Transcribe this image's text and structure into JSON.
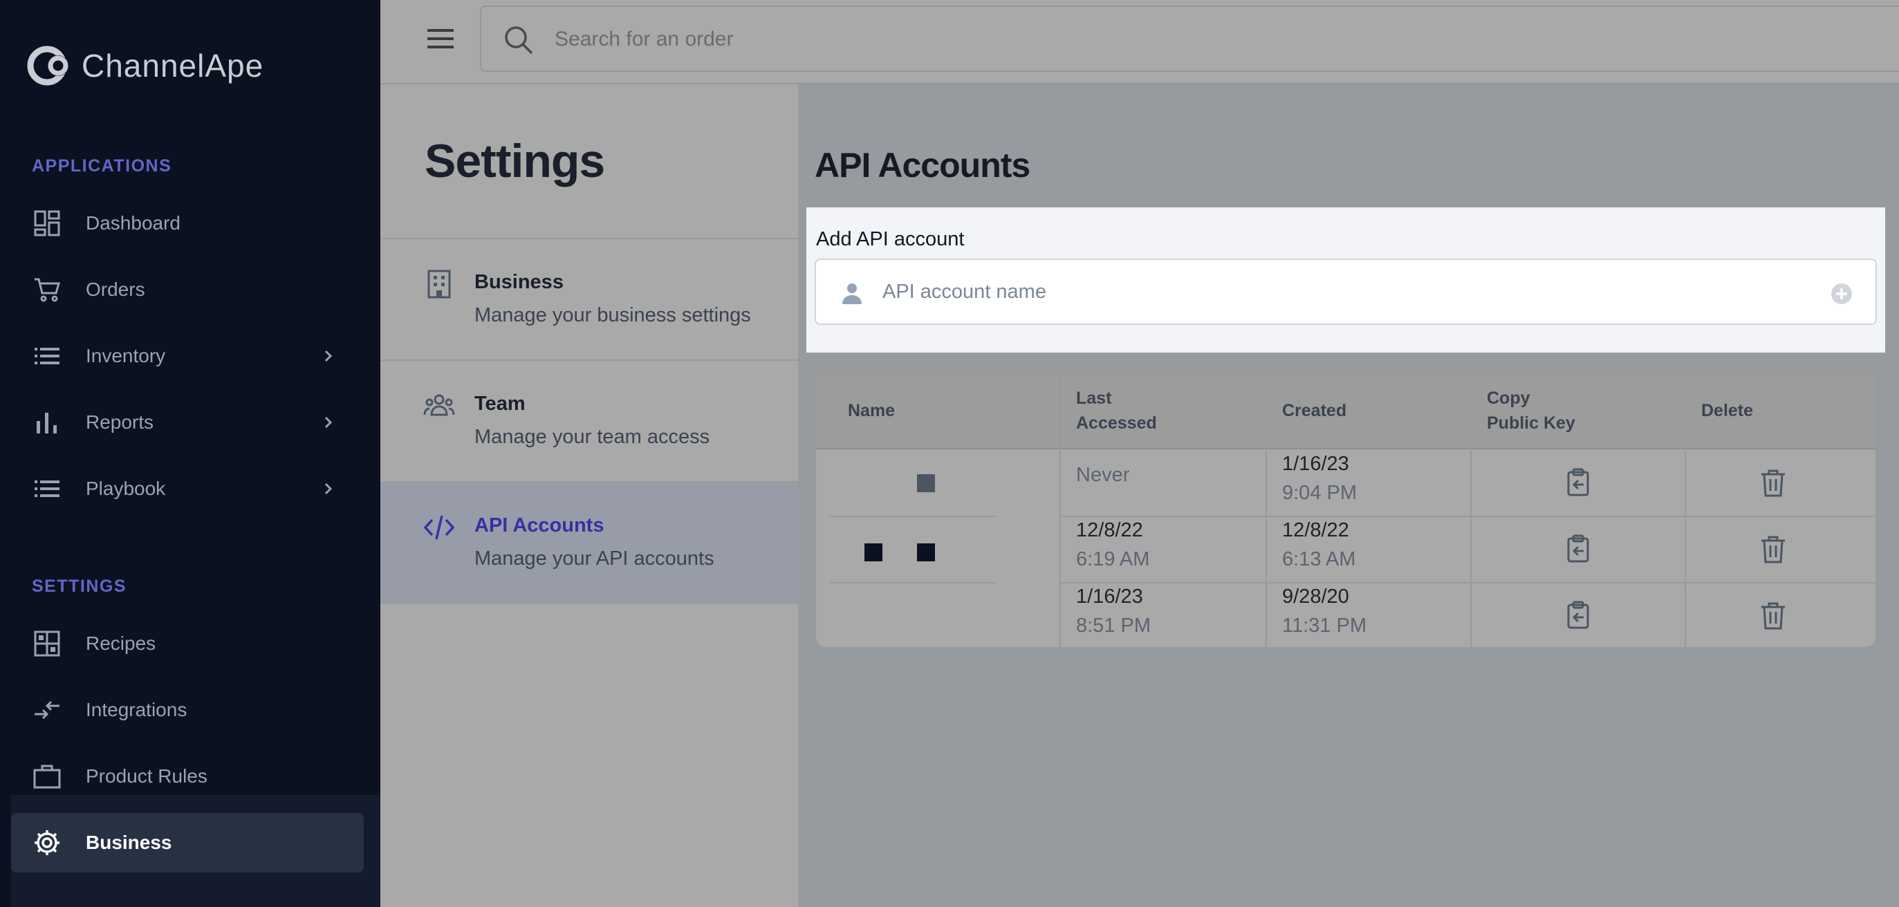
{
  "app": {
    "logo_text": "ChannelApe"
  },
  "sidebar": {
    "sections": [
      {
        "label": "APPLICATIONS"
      },
      {
        "label": "SETTINGS"
      }
    ],
    "items": [
      {
        "label": "Dashboard",
        "icon": "dashboard-icon"
      },
      {
        "label": "Orders",
        "icon": "cart-icon"
      },
      {
        "label": "Inventory",
        "icon": "list-icon",
        "expandable": true
      },
      {
        "label": "Reports",
        "icon": "bar-chart-icon",
        "expandable": true
      },
      {
        "label": "Playbook",
        "icon": "list-icon",
        "expandable": true
      },
      {
        "label": "Recipes",
        "icon": "recipes-icon"
      },
      {
        "label": "Integrations",
        "icon": "integrations-icon"
      },
      {
        "label": "Product Rules",
        "icon": "briefcase-icon"
      },
      {
        "label": "Business",
        "icon": "gear-icon",
        "active": true
      }
    ]
  },
  "topbar": {
    "search_placeholder": "Search for an order"
  },
  "settings": {
    "title": "Settings",
    "items": [
      {
        "title": "Business",
        "description": "Manage your business settings",
        "icon": "building-icon"
      },
      {
        "title": "Team",
        "description": "Manage your team access",
        "icon": "team-icon"
      },
      {
        "title": "API Accounts",
        "description": "Manage your API accounts",
        "icon": "code-icon",
        "active": true
      }
    ]
  },
  "api_accounts": {
    "title": "API Accounts",
    "add_label": "Add API account",
    "input_placeholder": "API account name",
    "columns": [
      "Name",
      "Last\nAccessed",
      "Created",
      "Copy\nPublic Key",
      "Delete"
    ],
    "rows": [
      {
        "name": "",
        "last_date": "Never",
        "last_time": "",
        "created_date": "1/16/23",
        "created_time": "9:04 PM"
      },
      {
        "name": "",
        "last_date": "12/8/22",
        "last_time": "6:19 AM",
        "created_date": "12/8/22",
        "created_time": "6:13 AM"
      },
      {
        "name": "",
        "last_date": "1/16/23",
        "last_time": "8:51 PM",
        "created_date": "9/28/20",
        "created_time": "11:31 PM"
      }
    ]
  },
  "colors": {
    "sidebar_bg": "#0b1120",
    "accent": "#3730a3",
    "section_label": "#6366c9"
  }
}
